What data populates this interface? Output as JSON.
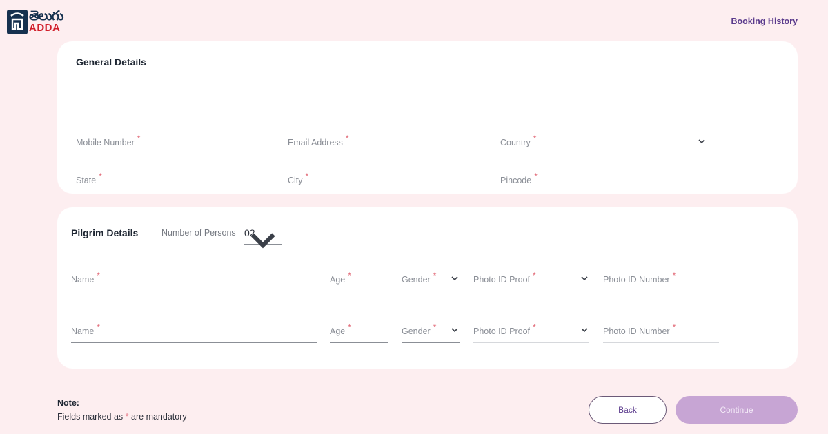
{
  "brand": {
    "logo_telugu": "తెలుగు",
    "logo_adda": "ADDA",
    "logo_bg": "#16314f",
    "accent": "#d11f2b"
  },
  "header": {
    "booking_history": "Booking History"
  },
  "general": {
    "title": "General Details",
    "fields": {
      "mobile": "Mobile Number",
      "email": "Email Address",
      "country": "Country",
      "state": "State",
      "city": "City",
      "pincode": "Pincode"
    }
  },
  "pilgrim": {
    "title": "Pilgrim Details",
    "persons_label": "Number of Persons",
    "persons_value": "02",
    "rows": [
      {
        "name": "Name",
        "age": "Age",
        "gender": "Gender",
        "id_proof": "Photo ID Proof",
        "id_number": "Photo ID Number"
      },
      {
        "name": "Name",
        "age": "Age",
        "gender": "Gender",
        "id_proof": "Photo ID Proof",
        "id_number": "Photo ID Number"
      }
    ]
  },
  "note": {
    "title": "Note:",
    "prefix": "Fields marked as",
    "star": "*",
    "suffix": "are mandatory"
  },
  "buttons": {
    "back": "Back",
    "continue": "Continue"
  },
  "required_marker": "*",
  "colors": {
    "background": "#fdeef0",
    "required": "#e26a78",
    "primary": "#5a3a8c",
    "continue_bg": "#c7a5d4"
  }
}
